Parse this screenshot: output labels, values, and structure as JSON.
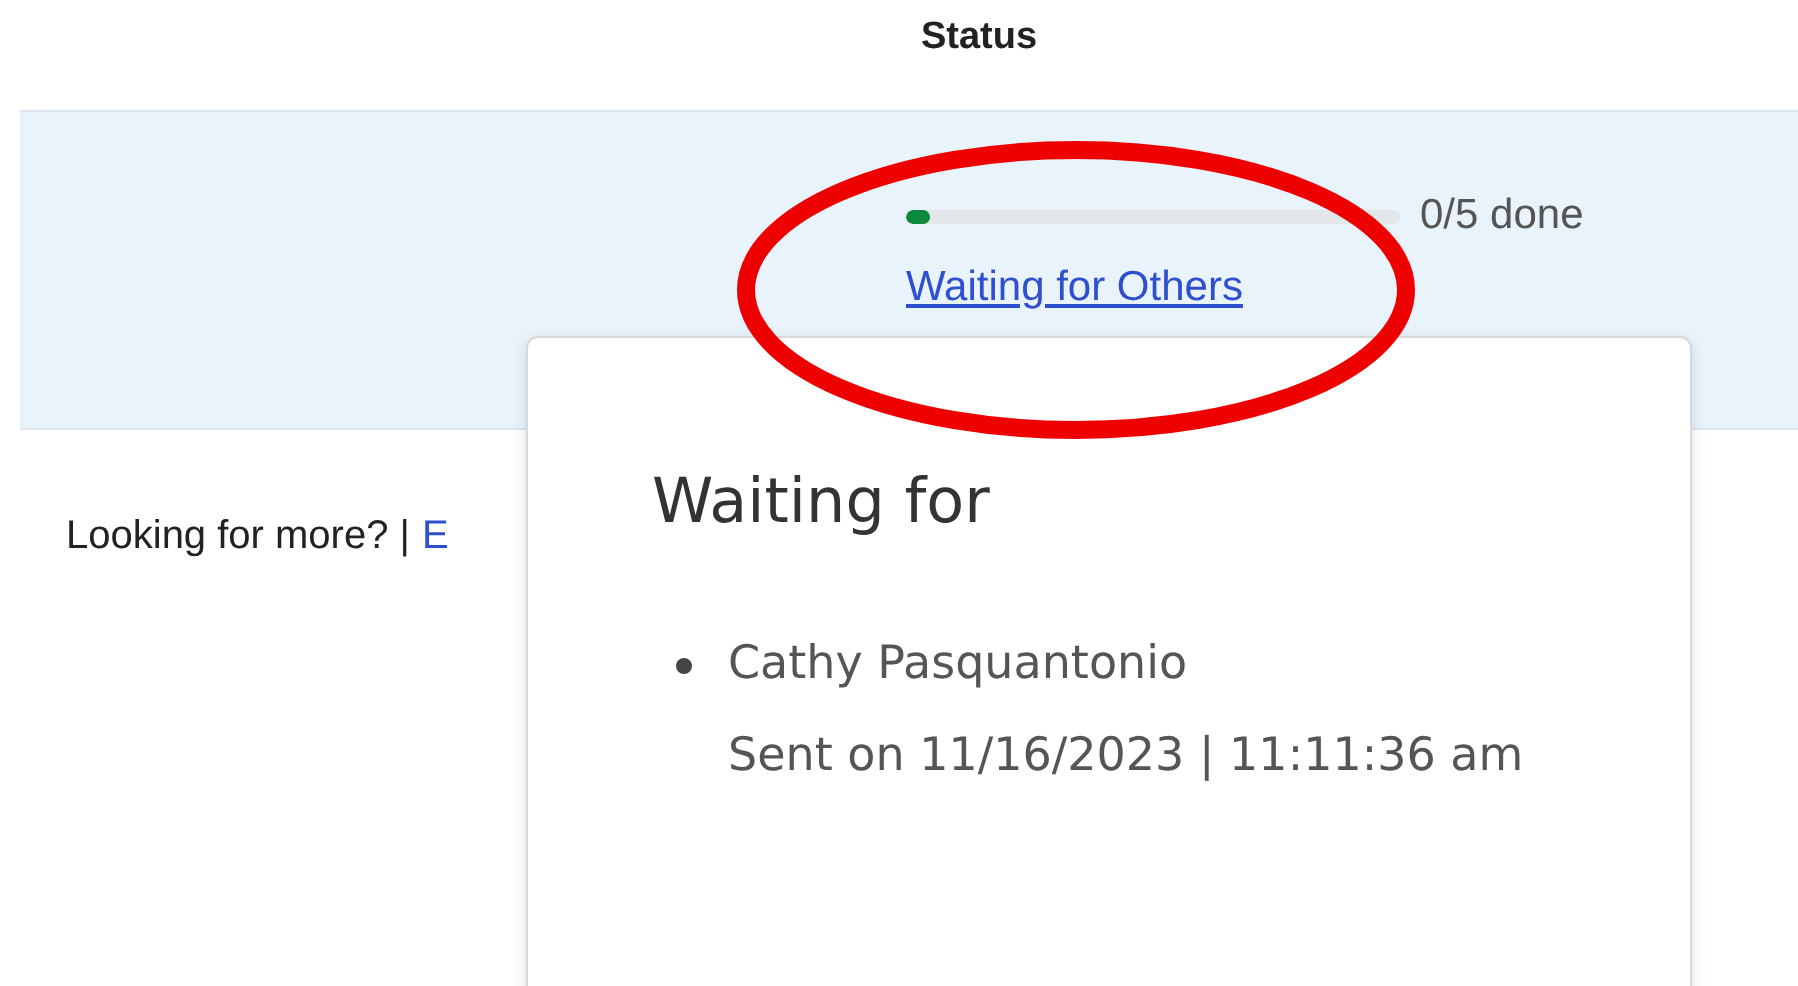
{
  "column_header": "Status",
  "row": {
    "progress": {
      "level": 0.05,
      "reading": "0/5 done"
    },
    "status_link": "Waiting for Others"
  },
  "footer": {
    "text": "Looking for more? |",
    "link": "E"
  },
  "popover": {
    "title": "Waiting for",
    "recipients": [
      {
        "name": "Cathy Pasquantonio",
        "sent": "Sent on 11/16/2023 | 11:11:36 am"
      }
    ]
  },
  "annotation": {
    "kind": "ellipse",
    "color": "#ee0000"
  }
}
